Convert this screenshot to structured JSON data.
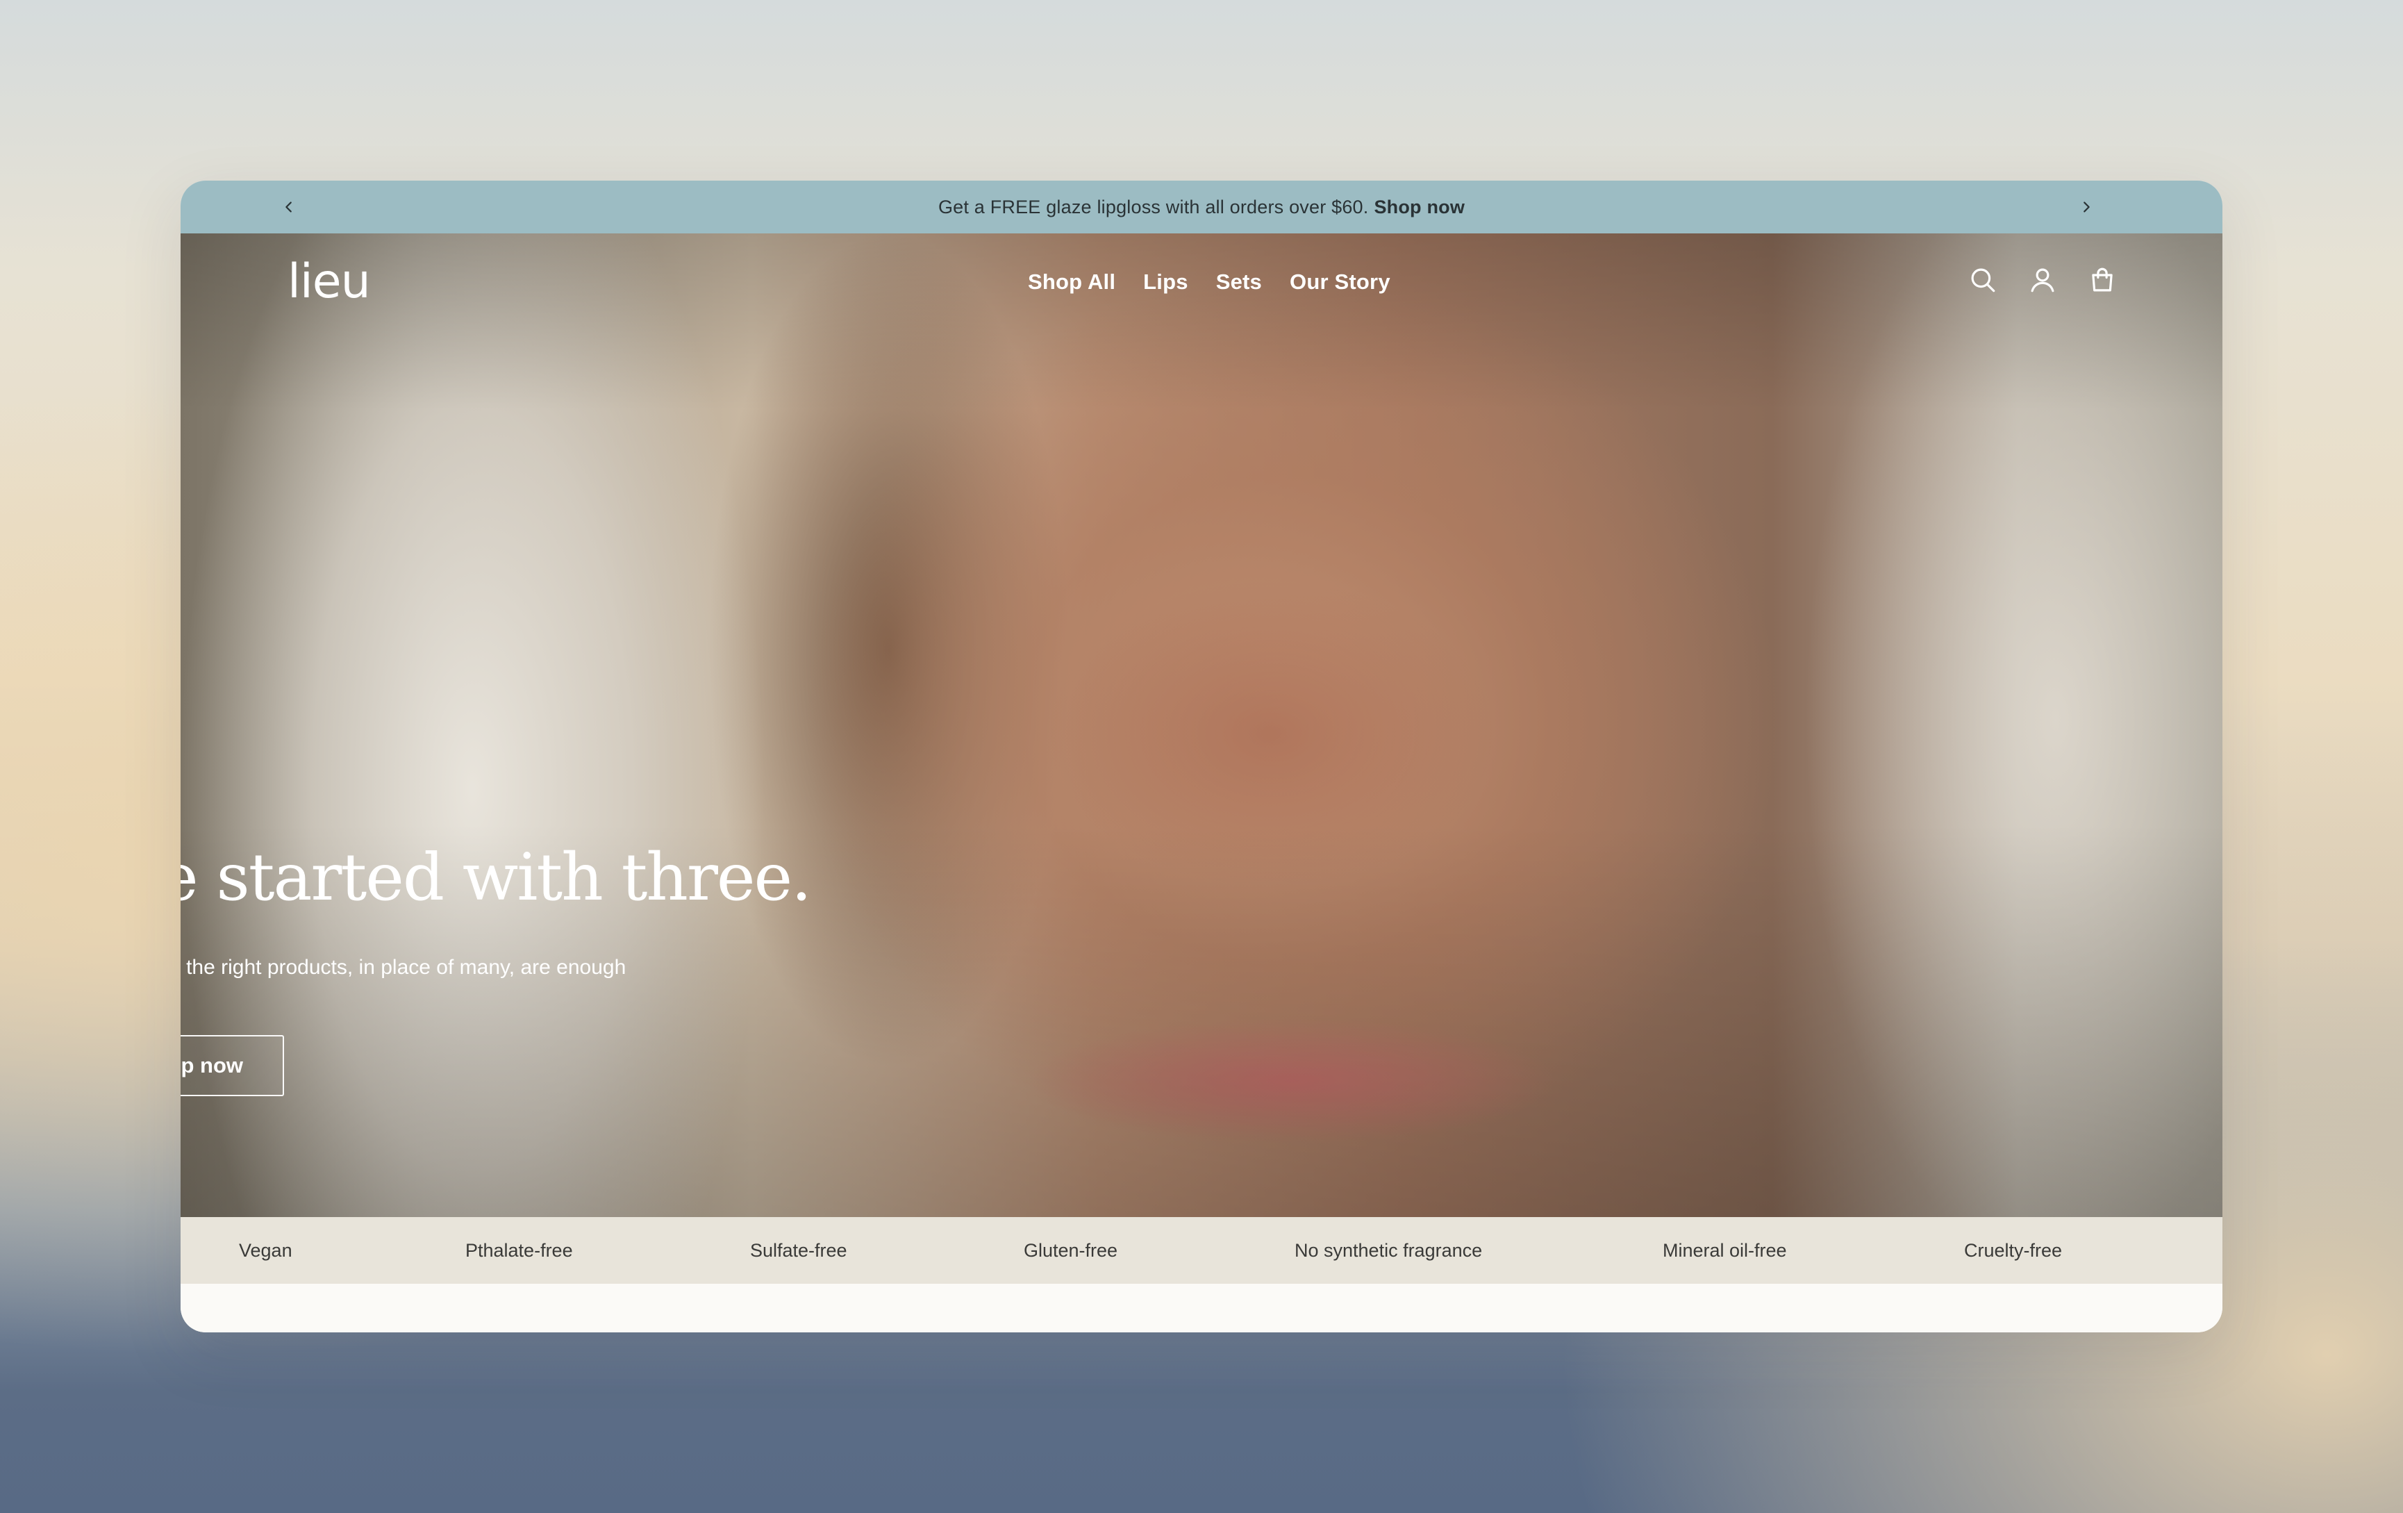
{
  "announcement": {
    "message": "Get a FREE glaze lipgloss with all orders over $60.",
    "link_label": "Shop now",
    "prev_icon": "chevron-left-icon",
    "next_icon": "chevron-right-icon",
    "background": "#9cbcc3"
  },
  "header": {
    "logo": "lieu",
    "nav": [
      {
        "label": "Shop All"
      },
      {
        "label": "Lips"
      },
      {
        "label": "Sets"
      },
      {
        "label": "Our Story"
      }
    ],
    "icons": [
      "search-icon",
      "account-icon",
      "shopping-bag-icon"
    ]
  },
  "hero": {
    "headline": "We started with three.",
    "subheadline": "Because the right products, in place of many, are enough",
    "cta_label": "Shop now"
  },
  "attributes": [
    "Vegan",
    "Pthalate-free",
    "Sulfate-free",
    "Gluten-free",
    "No synthetic fragrance",
    "Mineral oil-free",
    "Cruelty-free"
  ],
  "colors": {
    "announcement_bg": "#9cbcc3",
    "attributes_bg": "#e8e4da",
    "page_bg": "#fbfaf7"
  }
}
